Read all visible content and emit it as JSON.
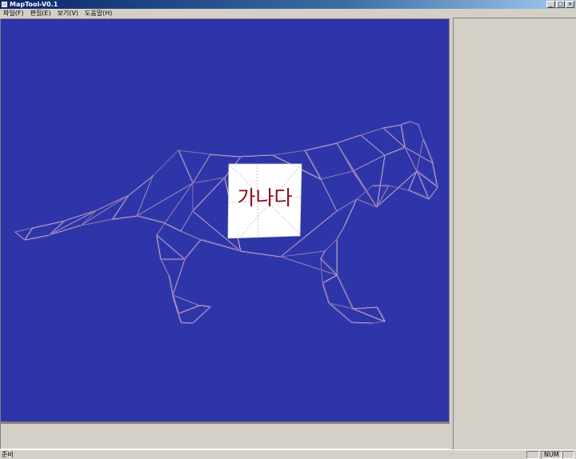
{
  "window": {
    "title": "MapTool-V0.1"
  },
  "menu": {
    "items": [
      "파일(F)",
      "편집(E)",
      "보기(V)",
      "도움말(H)"
    ]
  },
  "viewport": {
    "texture_label": "가나다"
  },
  "status": {
    "text": "준비",
    "indicators": [
      "",
      "NUM",
      ""
    ]
  },
  "colors": {
    "viewport_bg": "#2e35a8",
    "wire_light": "#e8e0ea",
    "wire_dark": "#7a5aa0",
    "label": "#8a0c12"
  }
}
